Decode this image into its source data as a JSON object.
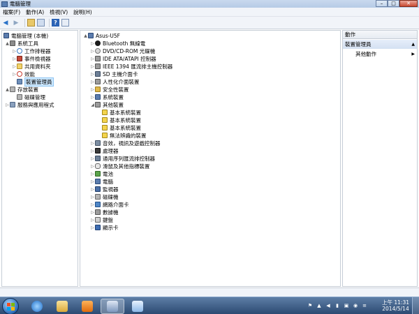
{
  "window": {
    "title": "電腦管理",
    "controls": {
      "minimize": "–",
      "maximize": "□",
      "close": "✕"
    }
  },
  "menu": [
    "檔案(F)",
    "動作(A)",
    "檢視(V)",
    "說明(H)"
  ],
  "toolbar": [
    "back-icon",
    "forward-icon",
    "up-icon",
    "properties-icon",
    "help-icon",
    "view-icon"
  ],
  "left_tree": [
    {
      "label": "電腦管理 (本機)",
      "icon": "computer-icon",
      "level": 0,
      "arrow": ""
    },
    {
      "label": "系統工具",
      "icon": "tools-icon",
      "level": 1,
      "arrow": "▲"
    },
    {
      "label": "工作排程器",
      "icon": "task-scheduler-icon",
      "level": 2,
      "arrow": "▷"
    },
    {
      "label": "事件檢視器",
      "icon": "event-viewer-icon",
      "level": 2,
      "arrow": "▷"
    },
    {
      "label": "共用資料夾",
      "icon": "shared-folder-icon",
      "level": 2,
      "arrow": "▷"
    },
    {
      "label": "效能",
      "icon": "performance-icon",
      "level": 2,
      "arrow": "▷"
    },
    {
      "label": "裝置管理員",
      "icon": "device-manager-icon",
      "level": 2,
      "arrow": "",
      "selected": true
    },
    {
      "label": "存放裝置",
      "icon": "storage-icon",
      "level": 1,
      "arrow": "▲"
    },
    {
      "label": "磁碟管理",
      "icon": "disk-management-icon",
      "level": 2,
      "arrow": ""
    },
    {
      "label": "服務與應用程式",
      "icon": "services-icon",
      "level": 1,
      "arrow": "▷"
    }
  ],
  "device_tree": {
    "root": "Asus-U5F",
    "items": [
      {
        "label": "Bluetooth 無線電",
        "icon": "bluetooth-icon",
        "arrow": "▷"
      },
      {
        "label": "DVD/CD-ROM 光碟機",
        "icon": "dvd-icon",
        "arrow": "▷"
      },
      {
        "label": "IDE ATA/ATAPI 控制器",
        "icon": "ide-controller-icon",
        "arrow": "▷"
      },
      {
        "label": "IEEE 1394 匯流排主機控制器",
        "icon": "ieee1394-icon",
        "arrow": "▷"
      },
      {
        "label": "SD 主機介面卡",
        "icon": "sd-host-icon",
        "arrow": "▷"
      },
      {
        "label": "人性化介面裝置",
        "icon": "hid-icon",
        "arrow": "▷"
      },
      {
        "label": "安全性裝置",
        "icon": "security-device-icon",
        "arrow": "▷"
      },
      {
        "label": "系統裝置",
        "icon": "system-device-icon",
        "arrow": "▷"
      },
      {
        "label": "其他裝置",
        "icon": "other-devices-icon",
        "arrow": "◢",
        "children": [
          {
            "label": "基本系統裝置",
            "icon": "warning-device-icon"
          },
          {
            "label": "基本系統裝置",
            "icon": "warning-device-icon"
          },
          {
            "label": "基本系統裝置",
            "icon": "warning-device-icon"
          },
          {
            "label": "無法辨識的裝置",
            "icon": "warning-device-icon"
          }
        ]
      },
      {
        "label": "音效，視訊及遊戲控制器",
        "icon": "sound-icon",
        "arrow": "▷"
      },
      {
        "label": "處理器",
        "icon": "processor-icon",
        "arrow": "▷"
      },
      {
        "label": "通用序列匯流排控制器",
        "icon": "usb-icon",
        "arrow": "▷"
      },
      {
        "label": "滑鼠及其他指標裝置",
        "icon": "mouse-icon",
        "arrow": "▷"
      },
      {
        "label": "電池",
        "icon": "battery-icon",
        "arrow": "▷"
      },
      {
        "label": "電腦",
        "icon": "computer-icon",
        "arrow": "▷"
      },
      {
        "label": "監視器",
        "icon": "monitor-icon",
        "arrow": "▷"
      },
      {
        "label": "磁碟機",
        "icon": "disk-drive-icon",
        "arrow": "▷"
      },
      {
        "label": "網路介面卡",
        "icon": "network-adapter-icon",
        "arrow": "▷"
      },
      {
        "label": "數據機",
        "icon": "modem-icon",
        "arrow": "▷"
      },
      {
        "label": "鍵盤",
        "icon": "keyboard-icon",
        "arrow": "▷"
      },
      {
        "label": "顯示卡",
        "icon": "display-adapter-icon",
        "arrow": "▷"
      }
    ]
  },
  "actions": {
    "header": "動作",
    "section": "裝置管理員",
    "section_caret": "▲",
    "item": "其他動作",
    "item_caret": "▶"
  },
  "taskbar": {
    "apps": [
      "ie-icon",
      "explorer-icon",
      "media-player-icon",
      "computer-management-icon",
      "paint-icon"
    ],
    "tray": [
      "flag-icon",
      "network-icon",
      "volume-icon",
      "power-icon"
    ],
    "tray_glyphs": [
      "⚑",
      "▲",
      "◀",
      "▮",
      "▣",
      "◉",
      "≡"
    ],
    "time": "上午 11:31",
    "date": "2014/5/14"
  },
  "colors": {
    "selection": "#cde8ff",
    "taskbar": "#2c4a72",
    "accent": "#2b63b5"
  }
}
